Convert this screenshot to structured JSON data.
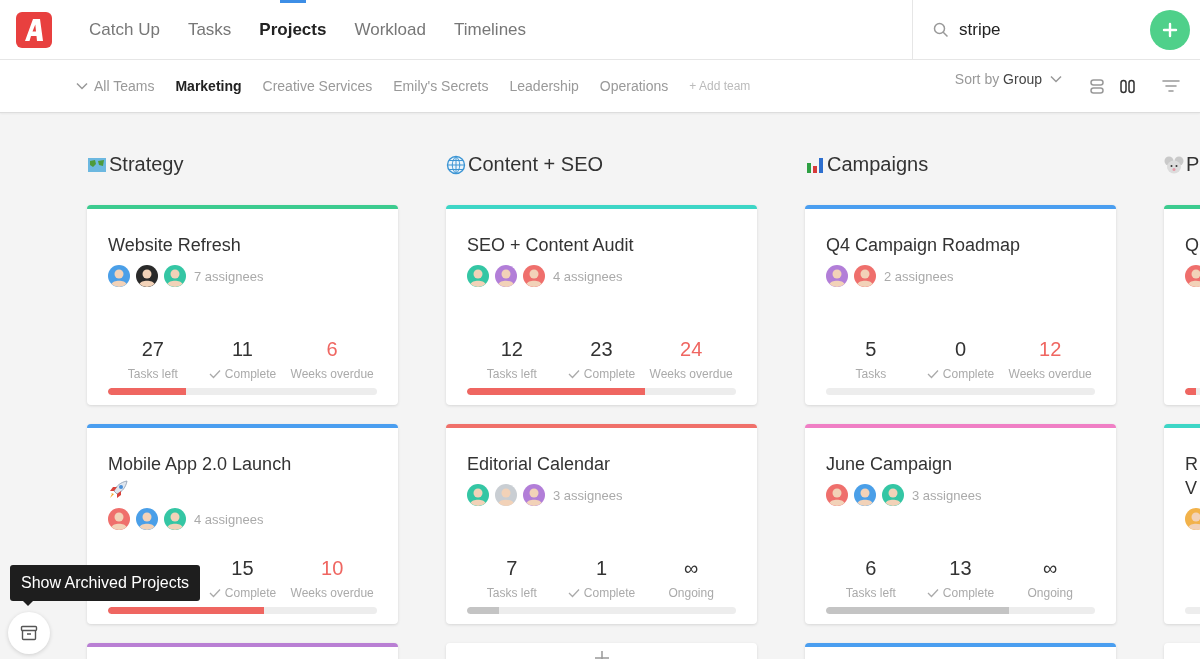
{
  "app_nav": {
    "tabs": [
      {
        "label": "Catch Up",
        "selected": false
      },
      {
        "label": "Tasks",
        "selected": false
      },
      {
        "label": "Projects",
        "selected": true
      },
      {
        "label": "Workload",
        "selected": false
      },
      {
        "label": "Timelines",
        "selected": false
      }
    ],
    "search": {
      "value": "stripe"
    }
  },
  "team_bar": {
    "all_teams": "All Teams",
    "teams": [
      {
        "label": "Marketing",
        "selected": true
      },
      {
        "label": "Creative Services",
        "selected": false
      },
      {
        "label": "Emily's Secrets",
        "selected": false
      },
      {
        "label": "Leadership",
        "selected": false
      },
      {
        "label": "Operations",
        "selected": false
      }
    ],
    "add_team": "+ Add team",
    "sort_prefix": "Sort by",
    "sort_value": "Group",
    "views": [
      {
        "kind": "rows",
        "selected": false
      },
      {
        "kind": "columns",
        "selected": true
      }
    ]
  },
  "columns": [
    {
      "title": "Strategy",
      "cards": [
        {
          "kind": "project",
          "color": "#3ccb8f",
          "title": "Website Refresh",
          "avatars": [
            {
              "color": "#4a9fe8"
            },
            {
              "color": "#2a2a2a"
            },
            {
              "color": "#34c6a4"
            }
          ],
          "assignees": "7 assignees",
          "stats": [
            {
              "kind": "tasks",
              "value": "27",
              "label": "Tasks left"
            },
            {
              "kind": "complete",
              "value": "11",
              "label": "Complete"
            },
            {
              "kind": "overdue",
              "value": "6",
              "label": "Weeks overdue"
            }
          ],
          "progress": {
            "level": 0.29,
            "overdue": true
          }
        },
        {
          "kind": "project",
          "color": "#4a9ef0",
          "title": "Mobile App 2.0 Launch",
          "rocket": true,
          "avatars": [
            {
              "color": "#ef6f6c"
            },
            {
              "color": "#4a9fe8"
            },
            {
              "color": "#34c6a4"
            }
          ],
          "assignees": "4 assignees",
          "stats": [
            {
              "kind": "complete",
              "value": "15",
              "label": "Complete"
            },
            {
              "kind": "overdue",
              "value": "10",
              "label": "Weeks overdue"
            }
          ],
          "progress": {
            "level": 0.58,
            "overdue": true
          }
        },
        {
          "kind": "stub",
          "color": "#b97fd4"
        }
      ]
    },
    {
      "title": "Content + SEO",
      "cards": [
        {
          "kind": "project",
          "color": "#3dd6c6",
          "title": "SEO + Content Audit",
          "avatars": [
            {
              "color": "#34c6a4"
            },
            {
              "color": "#b27ed8"
            },
            {
              "color": "#ef6f6c"
            }
          ],
          "assignees": "4 assignees",
          "stats": [
            {
              "kind": "tasks",
              "value": "12",
              "label": "Tasks left"
            },
            {
              "kind": "complete",
              "value": "23",
              "label": "Complete"
            },
            {
              "kind": "overdue",
              "value": "24",
              "label": "Weeks overdue"
            }
          ],
          "progress": {
            "level": 0.66,
            "overdue": true
          }
        },
        {
          "kind": "project",
          "color": "#f0706a",
          "title": "Editorial Calendar",
          "avatars": [
            {
              "color": "#34c6a4"
            },
            {
              "color": "#c9ced3"
            },
            {
              "color": "#b27ed8"
            }
          ],
          "assignees": "3 assignees",
          "stats": [
            {
              "kind": "tasks",
              "value": "7",
              "label": "Tasks left"
            },
            {
              "kind": "complete",
              "value": "1",
              "label": "Complete"
            },
            {
              "kind": "ongoing",
              "value": "∞",
              "label": "Ongoing"
            }
          ],
          "progress": {
            "level": 0.12,
            "overdue": false
          }
        },
        {
          "kind": "add"
        }
      ]
    },
    {
      "title": "Campaigns",
      "cards": [
        {
          "kind": "project",
          "color": "#4a9ef0",
          "title": "Q4 Campaign Roadmap",
          "avatars": [
            {
              "color": "#b27ed8"
            },
            {
              "color": "#ef6f6c"
            }
          ],
          "assignees": "2 assignees",
          "stats": [
            {
              "kind": "tasks",
              "value": "5",
              "label": "Tasks"
            },
            {
              "kind": "complete",
              "value": "0",
              "label": "Complete"
            },
            {
              "kind": "overdue",
              "value": "12",
              "label": "Weeks overdue"
            }
          ],
          "progress": {
            "level": 0
          }
        },
        {
          "kind": "project",
          "color": "#f07fc5",
          "title": "June Campaign",
          "avatars": [
            {
              "color": "#ef6f6c"
            },
            {
              "color": "#4a9fe8"
            },
            {
              "color": "#34c6a4"
            }
          ],
          "assignees": "3 assignees",
          "stats": [
            {
              "kind": "tasks",
              "value": "6",
              "label": "Tasks left"
            },
            {
              "kind": "complete",
              "value": "13",
              "label": "Complete"
            },
            {
              "kind": "ongoing",
              "value": "∞",
              "label": "Ongoing"
            }
          ],
          "progress": {
            "level": 0.68,
            "overdue": false
          }
        },
        {
          "kind": "stub",
          "color": "#4a9ef0"
        }
      ]
    },
    {
      "title": "P",
      "cards": [
        {
          "kind": "project",
          "color": "#3ccb8f",
          "title": "Q",
          "avatars": [
            {
              "color": "#ef6f6c"
            }
          ],
          "progress": {
            "level": 0.04,
            "overdue": true
          }
        },
        {
          "kind": "project",
          "color": "#3dd6c6",
          "title": "R\nV",
          "avatars": [
            {
              "color": "#f2b24a"
            }
          ],
          "progress": {
            "level": 0
          }
        },
        {
          "kind": "stub"
        }
      ]
    }
  ],
  "archive": {
    "tooltip": "Show Archived Projects"
  }
}
